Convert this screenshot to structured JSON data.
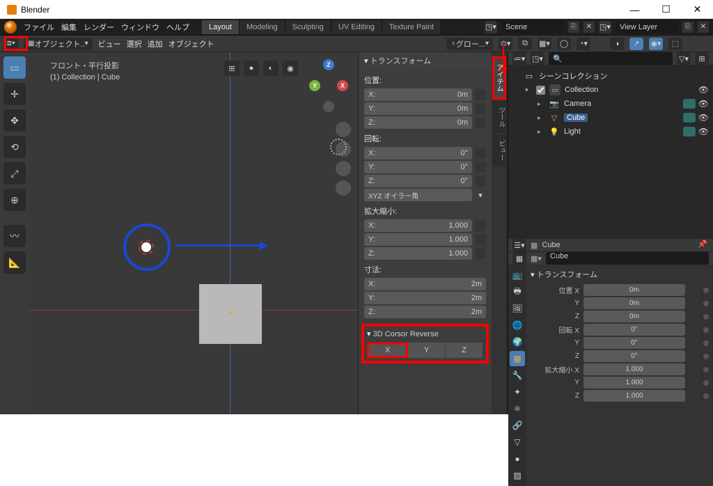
{
  "window": {
    "title": "Blender"
  },
  "menubar": {
    "file": "ファイル",
    "edit": "編集",
    "render": "レンダー",
    "window": "ウィンドウ",
    "help": "ヘルプ"
  },
  "workspaces": {
    "layout": "Layout",
    "modeling": "Modeling",
    "sculpting": "Sculpting",
    "uv": "UV Editing",
    "texture": "Texture Paint"
  },
  "scene_field": "Scene",
  "layer_field": "View Layer",
  "toolbar": {
    "mode": "オブジェクト..",
    "view": "ビュー",
    "select": "選択",
    "add": "追加",
    "object": "オブジェクト",
    "global": "グロー..."
  },
  "viewport_info": {
    "line1": "フロント・平行投影",
    "line2": "(1) Collection | Cube"
  },
  "gizmo": {
    "x": "X",
    "y": "Y",
    "z": "Z"
  },
  "npanel": {
    "transform": "トランスフォーム",
    "location": "位置:",
    "rotation": "回転:",
    "euler": "XYZ オイラー角",
    "scale": "拡大縮小:",
    "dimensions": "寸法:",
    "loc": {
      "x_label": "X:",
      "x_val": "0m",
      "y_label": "Y:",
      "y_val": "0m",
      "z_label": "Z:",
      "z_val": "0m"
    },
    "rot": {
      "x_label": "X:",
      "x_val": "0°",
      "y_label": "Y:",
      "y_val": "0°",
      "z_label": "Z:",
      "z_val": "0°"
    },
    "scl": {
      "x_label": "X:",
      "x_val": "1.000",
      "y_label": "Y:",
      "y_val": "1.000",
      "z_label": "Z:",
      "z_val": "1.000"
    },
    "dim": {
      "x_label": "X:",
      "x_val": "2m",
      "y_label": "Y:",
      "y_val": "2m",
      "z_label": "Z:",
      "z_val": "2m"
    },
    "cursor_rev": "3D Corsor Reverse",
    "btn_x": "X",
    "btn_y": "Y",
    "btn_z": "Z"
  },
  "vtabs": {
    "item": "アイテム",
    "tool": "ツール",
    "view": "ビュー"
  },
  "outliner": {
    "scene_collection": "シーンコレクション",
    "collection": "Collection",
    "camera": "Camera",
    "cube": "Cube",
    "light": "Light"
  },
  "props": {
    "obj_name": "Cube",
    "obj_name2": "Cube",
    "transform": "トランスフォーム",
    "loc_x": "位置 X",
    "loc_y": "Y",
    "loc_z": "Z",
    "rot_x": "回転 X",
    "rot_y": "Y",
    "rot_z": "Z",
    "scl_x": "拡大縮小 X",
    "scl_y": "Y",
    "scl_z": "Z",
    "v_loc_x": "0m",
    "v_loc_y": "0m",
    "v_loc_z": "0m",
    "v_rot_x": "0°",
    "v_rot_y": "0°",
    "v_rot_z": "0°",
    "v_scl_x": "1.000",
    "v_scl_y": "1.000",
    "v_scl_z": "1.000"
  }
}
